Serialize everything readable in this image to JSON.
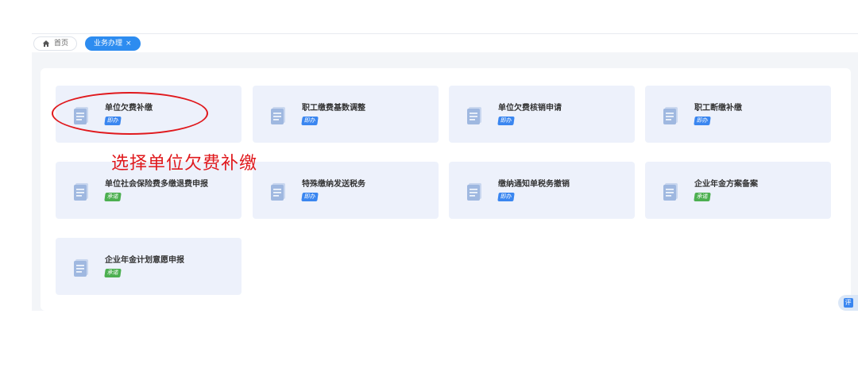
{
  "tabs": {
    "home_label": "首页",
    "active_label": "业务办理",
    "close_symbol": "×"
  },
  "cards": [
    {
      "title": "单位欠费补缴",
      "badge": "即办",
      "badge_color": "#3a86f0"
    },
    {
      "title": "职工缴费基数调整",
      "badge": "即办",
      "badge_color": "#3a86f0"
    },
    {
      "title": "单位欠费核销申请",
      "badge": "即办",
      "badge_color": "#3a86f0"
    },
    {
      "title": "职工断缴补缴",
      "badge": "即办",
      "badge_color": "#3a86f0"
    },
    {
      "title": "单位社会保险费多缴退费申报",
      "badge": "承诺",
      "badge_color": "#4caf50"
    },
    {
      "title": "特殊缴纳发送税务",
      "badge": "即办",
      "badge_color": "#3a86f0"
    },
    {
      "title": "缴纳通知单税务撤销",
      "badge": "即办",
      "badge_color": "#3a86f0"
    },
    {
      "title": "企业年金方案备案",
      "badge": "承诺",
      "badge_color": "#4caf50"
    },
    {
      "title": "企业年金计划意愿申报",
      "badge": "承诺",
      "badge_color": "#4caf50"
    }
  ],
  "annotation": {
    "text": "选择单位欠费补缴",
    "color": "#e0191d"
  },
  "float_button": {
    "label": "评"
  },
  "icons": {
    "home": "home-icon",
    "card": "document-icon",
    "float": "evaluate-icon"
  },
  "colors": {
    "accent": "#2d8cf0",
    "card_bg": "#edf1fb",
    "badge_blue": "#3a86f0",
    "badge_green": "#4caf50"
  }
}
